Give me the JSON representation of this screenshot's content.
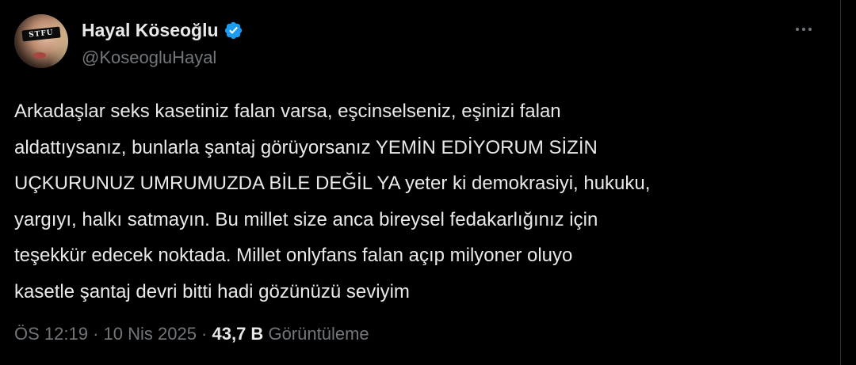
{
  "author": {
    "display_name": "Hayal Köseoğlu",
    "handle": "@KoseogluHayal",
    "verified": true,
    "avatar_text": "STFU"
  },
  "tweet": {
    "lines": [
      "Arkadaşlar seks kasetiniz falan varsa, eşcinselseniz, eşinizi falan",
      "aldattıysanız, bunlarla şantaj görüyorsanız YEMİN EDİYORUM SİZİN",
      "UÇKURUNUZ UMRUMUZDA BİLE DEĞİL YA yeter ki demokrasiyi, hukuku,",
      "yargıyı, halkı satmayın. Bu millet size anca bireysel fedakarlığınız için",
      "teşekkür edecek noktada. Millet onlyfans falan açıp milyoner oluyo",
      "kasetle şantaj devri bitti hadi gözünüzü seviyim"
    ]
  },
  "meta": {
    "time": "ÖS 12:19",
    "separator": " · ",
    "date": "10 Nis 2025",
    "views_count": "43,7 B",
    "views_label": "Görüntüleme"
  },
  "icons": {
    "verified": "verified-badge-icon",
    "more": "more-horizontal-icon"
  },
  "colors": {
    "background": "#000000",
    "text_primary": "#e7e9ea",
    "text_secondary": "#71767b",
    "verified_blue": "#1d9bf0"
  }
}
